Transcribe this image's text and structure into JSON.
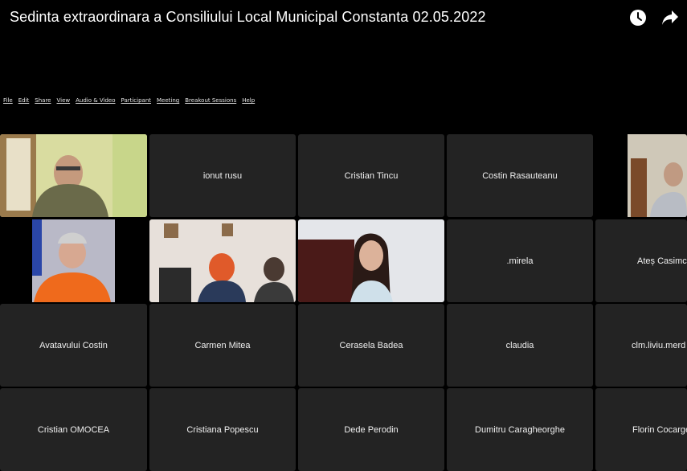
{
  "video_title": "Sedinta extraordinara a Consiliului Local Municipal Constanta 02.05.2022",
  "top_icons": [
    "watch-later-icon",
    "share-icon"
  ],
  "menu": [
    "File",
    "Edit",
    "Share",
    "View",
    "Audio & Video",
    "Participant",
    "Meeting",
    "Breakout Sessions",
    "Help"
  ],
  "participants": {
    "row1": [
      "ionut rusu",
      "Cristian Tincu",
      "Costin Rasauteanu"
    ],
    "row2": [
      ".mirela",
      "Ateș Casimc"
    ],
    "row3": [
      "Avatavului Costin",
      "Carmen Mitea",
      "Cerasela Badea",
      "claudia",
      "clm.liviu.merd"
    ],
    "row4": [
      "Cristian OMOCEA",
      "Cristiana Popescu",
      "Dede Perodin",
      "Dumitru Caragheorghe",
      "Florin Cocarge"
    ]
  }
}
